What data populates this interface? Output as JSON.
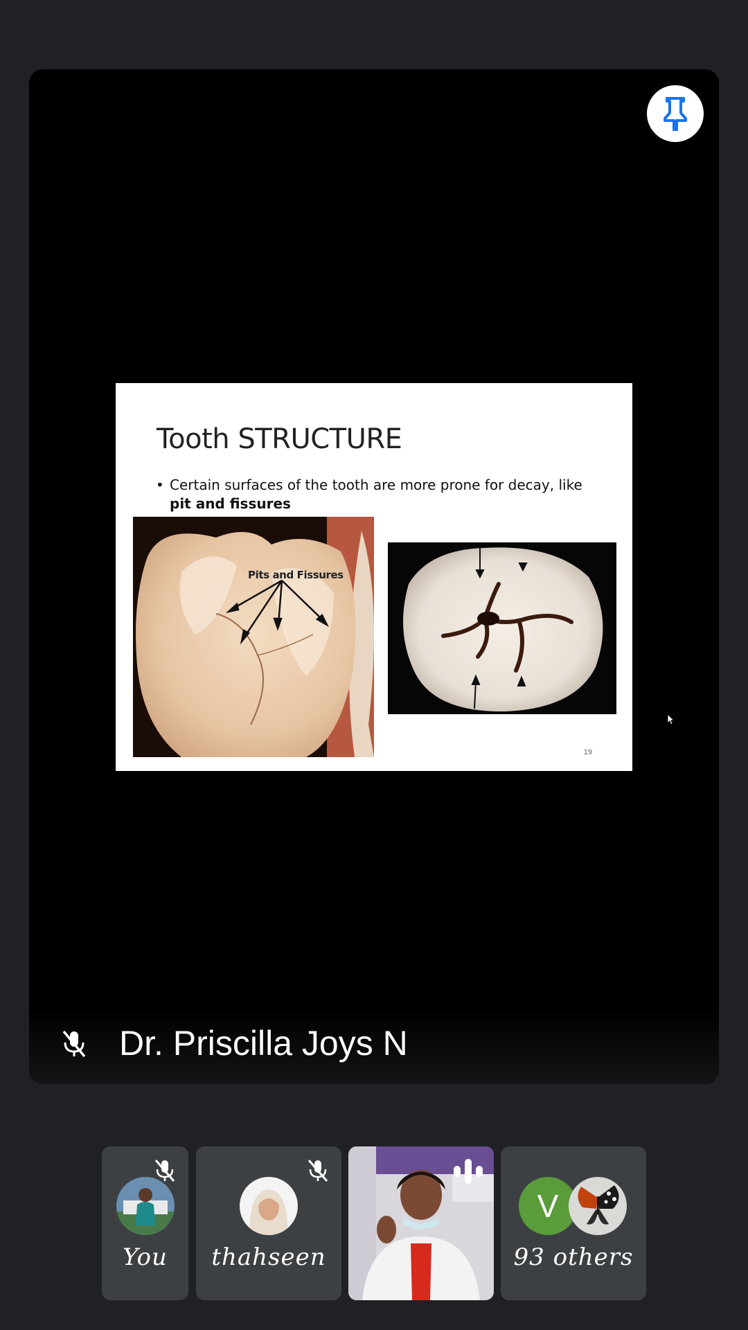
{
  "main_view": {
    "speaker_name": "Dr. Priscilla Joys N",
    "speaker_muted": true,
    "pin_icon": "pin-icon"
  },
  "slide": {
    "title": "Tooth STRUCTURE",
    "bullet_text": "Certain surfaces of the tooth are more prone for decay, like",
    "bullet_bold": "pit and fissures",
    "image_left_label": "Pits and Fissures",
    "page_number": "19"
  },
  "participants": [
    {
      "name": "You",
      "muted": true
    },
    {
      "name": "thahseen",
      "muted": true
    },
    {
      "name": "",
      "speaking": true
    },
    {
      "name": "93 others",
      "avatar_letter": "V"
    }
  ],
  "colors": {
    "background": "#202124",
    "tile": "#3c4043",
    "pin_accent": "#1a73e8",
    "avatar_v": "#5a9b3a"
  }
}
